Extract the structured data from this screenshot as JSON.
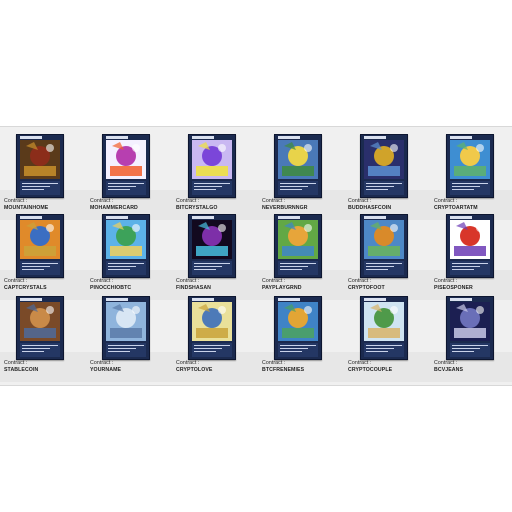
{
  "contract_label": "Contract :",
  "cards": [
    {
      "name": "MOUNTAINHOME",
      "colors": [
        "#5a3a1a",
        "#8b2d1a",
        "#c9902c"
      ]
    },
    {
      "name": "MOHAMMERCARD",
      "colors": [
        "#f4f0ff",
        "#b73fb0",
        "#f25d2a"
      ]
    },
    {
      "name": "BITCRYSTALGO",
      "colors": [
        "#c9b8f2",
        "#7b46d9",
        "#f1e33a"
      ]
    },
    {
      "name": "NEVERBURNNGR",
      "colors": [
        "#4a79b8",
        "#e8d34a",
        "#3e8b3e"
      ]
    },
    {
      "name": "BUDDHASFCOIN",
      "colors": [
        "#2a2f6b",
        "#d0a32a",
        "#5c8fd1"
      ]
    },
    {
      "name": "CRYPTOARTATM",
      "colors": [
        "#3e8ed2",
        "#f0c94a",
        "#5fb36b"
      ]
    },
    {
      "name": "CAPTCRYSTALS",
      "colors": [
        "#e08a2a",
        "#3b6ec2",
        "#caa33a"
      ]
    },
    {
      "name": "PINOCCHIOBTC",
      "colors": [
        "#5cb2e8",
        "#3da25a",
        "#f1d05a"
      ]
    },
    {
      "name": "FINDSHASAN",
      "colors": [
        "#12091f",
        "#7d2fa8",
        "#48c0e0"
      ]
    },
    {
      "name": "PAYPLAYGRND",
      "colors": [
        "#62a845",
        "#e7a53a",
        "#3f86c9"
      ]
    },
    {
      "name": "CRYPTOFOOT",
      "colors": [
        "#4d88c7",
        "#d98a2a",
        "#6ab55a"
      ]
    },
    {
      "name": "PISEOSPONER",
      "colors": [
        "#ffffff",
        "#d8362a",
        "#6b3bb5"
      ]
    },
    {
      "name": "STABLECOIN",
      "colors": [
        "#7a4a28",
        "#c98a48",
        "#4d6a9a"
      ]
    },
    {
      "name": "YOURNAME",
      "colors": [
        "#8fb4dc",
        "#d8e6f4",
        "#5a7aa8"
      ]
    },
    {
      "name": "CRYPTOLOVE",
      "colors": [
        "#e9e09a",
        "#4d7ab8",
        "#c9a23a"
      ]
    },
    {
      "name": "BTCFRENEMIES",
      "colors": [
        "#3f83c6",
        "#e2a535",
        "#4ca35e"
      ]
    },
    {
      "name": "CRYPTOCOUPLE",
      "colors": [
        "#cfe4f2",
        "#4f9a4a",
        "#d8b46a"
      ]
    },
    {
      "name": "BCVJEANS",
      "colors": [
        "#1c1f52",
        "#6a6fb8",
        "#c9c9e8"
      ]
    }
  ]
}
